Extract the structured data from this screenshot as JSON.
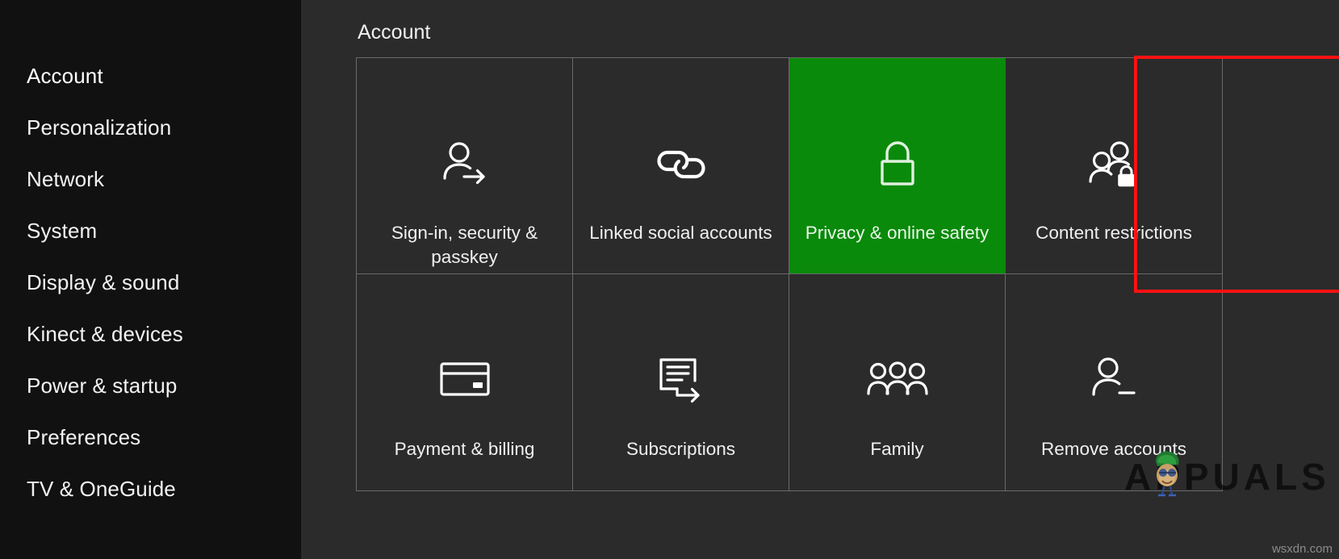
{
  "sidebar": {
    "items": [
      {
        "label": "Account",
        "icon": "account-icon",
        "selected": true
      },
      {
        "label": "Personalization",
        "icon": "personalization-icon",
        "selected": false
      },
      {
        "label": "Network",
        "icon": "network-icon",
        "selected": false
      },
      {
        "label": "System",
        "icon": "system-icon",
        "selected": false
      },
      {
        "label": "Display & sound",
        "icon": "display-sound-icon",
        "selected": false
      },
      {
        "label": "Kinect & devices",
        "icon": "kinect-devices-icon",
        "selected": false
      },
      {
        "label": "Power & startup",
        "icon": "power-startup-icon",
        "selected": false
      },
      {
        "label": "Preferences",
        "icon": "preferences-icon",
        "selected": false
      },
      {
        "label": "TV & OneGuide",
        "icon": "tv-oneguide-icon",
        "selected": false
      }
    ]
  },
  "main": {
    "title": "Account",
    "tiles": [
      {
        "label": "Sign-in, security & passkey",
        "icon": "person-arrow-icon",
        "highlighted": false
      },
      {
        "label": "Linked social accounts",
        "icon": "chain-link-icon",
        "highlighted": false
      },
      {
        "label": "Privacy & online safety",
        "icon": "lock-icon",
        "highlighted": true
      },
      {
        "label": "Content restrictions",
        "icon": "people-lock-icon",
        "highlighted": false
      },
      {
        "label": "Payment & billing",
        "icon": "credit-card-icon",
        "highlighted": false
      },
      {
        "label": "Subscriptions",
        "icon": "document-arrow-icon",
        "highlighted": false
      },
      {
        "label": "Family",
        "icon": "people-group-icon",
        "highlighted": false
      },
      {
        "label": "Remove accounts",
        "icon": "person-minus-icon",
        "highlighted": false
      }
    ]
  },
  "annotation": {
    "highlight_border_color": "#ff1111",
    "highlight_fill_color": "#0a8a0a"
  },
  "watermark": {
    "brand": "APPUALS",
    "corner_url": "wsxdn.com"
  },
  "theme": {
    "sidebar_bg": "#111111",
    "panel_bg": "#2b2b2b",
    "grid_line": "#6a6a6a",
    "text": "#f0f0f0"
  }
}
